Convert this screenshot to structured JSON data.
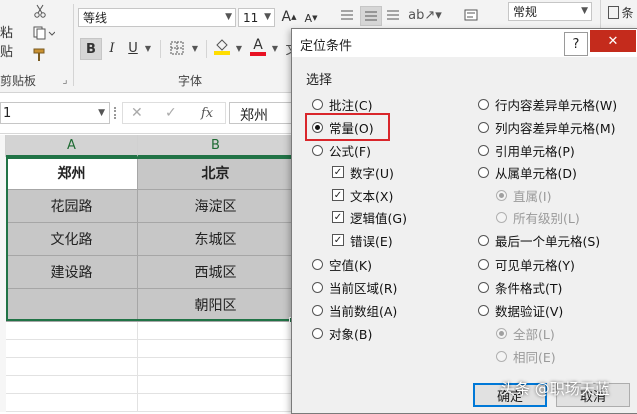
{
  "ribbon": {
    "paste_label": "粘贴",
    "clipboard_label": "剪贴板",
    "font_name": "等线",
    "font_size": "11",
    "bold": "B",
    "italic": "I",
    "underline": "U",
    "font_group_label": "字体",
    "fill_letter": "A",
    "font_color_letter": "A",
    "wen": "文",
    "number_format": "常规",
    "partial_right_label": "条",
    "grow_font": "A",
    "shrink_font": "A",
    "font_color_accent": "#e81123",
    "fill_color_accent": "#ffdd00"
  },
  "formula_bar": {
    "name_box": "1",
    "fx": "fx",
    "cancel": "✕",
    "enter": "✓",
    "content": "郑州"
  },
  "grid": {
    "columns": [
      "A",
      "B"
    ],
    "rows": [
      [
        "郑州",
        "北京"
      ],
      [
        "花园路",
        "海淀区"
      ],
      [
        "文化路",
        "东城区"
      ],
      [
        "建设路",
        "西城区"
      ],
      [
        "",
        "朝阳区"
      ]
    ]
  },
  "dialog": {
    "title": "定位条件",
    "help": "?",
    "close": "✕",
    "section_label": "选择",
    "left_options": [
      {
        "label": "批注(C)",
        "type": "radio",
        "checked": false
      },
      {
        "label": "常量(O)",
        "type": "radio",
        "checked": true
      },
      {
        "label": "公式(F)",
        "type": "radio",
        "checked": false
      },
      {
        "label": "数字(U)",
        "type": "check",
        "checked": true
      },
      {
        "label": "文本(X)",
        "type": "check",
        "checked": true
      },
      {
        "label": "逻辑值(G)",
        "type": "check",
        "checked": true
      },
      {
        "label": "错误(E)",
        "type": "check",
        "checked": true
      },
      {
        "label": "空值(K)",
        "type": "radio",
        "checked": false
      },
      {
        "label": "当前区域(R)",
        "type": "radio",
        "checked": false
      },
      {
        "label": "当前数组(A)",
        "type": "radio",
        "checked": false
      },
      {
        "label": "对象(B)",
        "type": "radio",
        "checked": false
      }
    ],
    "right_options": [
      {
        "label": "行内容差异单元格(W)",
        "disabled": false,
        "checked": false
      },
      {
        "label": "列内容差异单元格(M)",
        "disabled": false,
        "checked": false
      },
      {
        "label": "引用单元格(P)",
        "disabled": false,
        "checked": false
      },
      {
        "label": "从属单元格(D)",
        "disabled": false,
        "checked": false
      },
      {
        "label": "直属(I)",
        "disabled": true,
        "checked": true
      },
      {
        "label": "所有级别(L)",
        "disabled": true,
        "checked": false
      },
      {
        "label": "最后一个单元格(S)",
        "disabled": false,
        "checked": false
      },
      {
        "label": "可见单元格(Y)",
        "disabled": false,
        "checked": false
      },
      {
        "label": "条件格式(T)",
        "disabled": false,
        "checked": false
      },
      {
        "label": "数据验证(V)",
        "disabled": false,
        "checked": false
      },
      {
        "label": "全部(L)",
        "disabled": true,
        "checked": true
      },
      {
        "label": "相同(E)",
        "disabled": true,
        "checked": false
      }
    ],
    "ok_label": "确定",
    "cancel_label": "取消",
    "highlight_color": "#d9262b"
  },
  "watermark": "头条 @职场天蓝"
}
